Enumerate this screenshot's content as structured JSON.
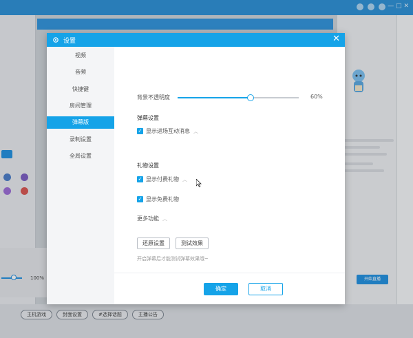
{
  "app": {
    "brand": "",
    "window_controls": "— □ ✕"
  },
  "background": {
    "bottom_tags": [
      "主机游戏",
      "封面设置",
      "#选择话题",
      "主播公告"
    ],
    "left_percent": "100%",
    "right_start_button": "开始直播"
  },
  "dialog": {
    "title": "设置",
    "close": "✕",
    "nav": [
      {
        "label": "视频",
        "active": false
      },
      {
        "label": "音频",
        "active": false
      },
      {
        "label": "快捷键",
        "active": false
      },
      {
        "label": "房间管理",
        "active": false
      },
      {
        "label": "弹幕版",
        "active": true
      },
      {
        "label": "录制设置",
        "active": false
      },
      {
        "label": "全局设置",
        "active": false
      }
    ],
    "opacity": {
      "label": "背景不透明度",
      "value_text": "60%",
      "value": 0.6
    },
    "danmaku_section": {
      "title": "弹幕设置",
      "show_enter_label": "显示进场互动消息"
    },
    "gift_section": {
      "title": "礼物设置",
      "show_paid_label": "显示付费礼物",
      "show_free_label": "显示免费礼物"
    },
    "more_section": {
      "title": "更多功能"
    },
    "restore_button": "还原设置",
    "test_button": "测试效果",
    "hint": "开启弹幕后才能测试弹幕效果哦~",
    "ok_button": "确定",
    "cancel_button": "取消"
  },
  "colors": {
    "accent": "#15a3e8",
    "titlebar": "#15a3e8",
    "background_header": "#2a8fd6"
  }
}
